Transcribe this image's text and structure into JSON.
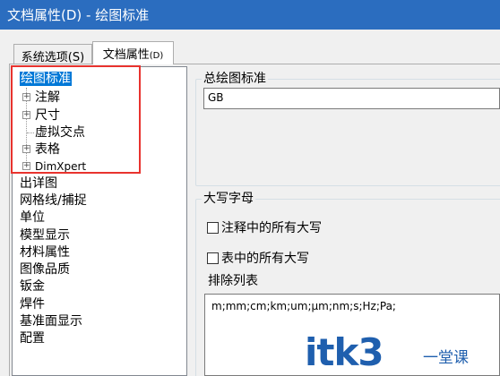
{
  "window": {
    "title": "文档属性(D) - 绘图标准"
  },
  "tabs": [
    {
      "label": "系统选项(S)",
      "active": false
    },
    {
      "label": "文档属性",
      "suffix": "(D)",
      "active": true
    }
  ],
  "tree": {
    "selected": "绘图标准",
    "root": {
      "label": "绘图标准"
    },
    "children": [
      {
        "label": "注解",
        "expander": "+"
      },
      {
        "label": "尺寸",
        "expander": "+"
      },
      {
        "label": "虚拟交点",
        "expander": ""
      },
      {
        "label": "表格",
        "expander": "+"
      },
      {
        "label": "DimXpert",
        "expander": "+"
      }
    ],
    "items": [
      "出详图",
      "网格线/捕捉",
      "单位",
      "模型显示",
      "材料属性",
      "图像品质",
      "钣金",
      "焊件",
      "基准面显示",
      "配置"
    ]
  },
  "overall_standard": {
    "group_label": "总绘图标准",
    "value": "GB"
  },
  "uppercase": {
    "group_label": "大写字母",
    "option_notes": {
      "label": "注释中的所有大写",
      "checked": false
    },
    "option_tables": {
      "label": "表中的所有大写",
      "checked": false
    },
    "exclusion_label": "排除列表",
    "exclusion_value": "m;mm;cm;km;um;µm;nm;s;Hz;Pa;"
  },
  "watermark": {
    "main": "itk3",
    "sub": "一堂课"
  },
  "colors": {
    "titlebar": "#2b6dbf",
    "selection": "#0078d7",
    "highlight_box": "#e8332e",
    "watermark": "#1f5fae"
  }
}
